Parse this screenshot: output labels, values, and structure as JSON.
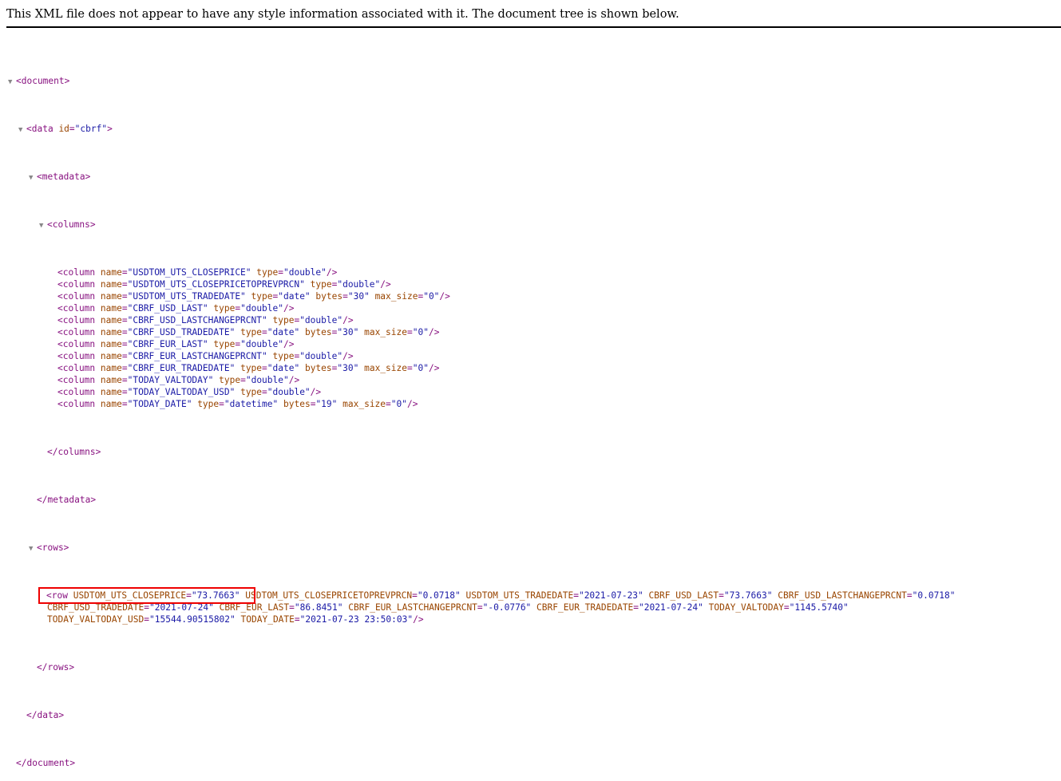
{
  "notice": "This XML file does not appear to have any style information associated with it. The document tree is shown below.",
  "document": {
    "open": "<document>",
    "close": "</document>"
  },
  "data": {
    "open_tag": "<data",
    "id_attr": "id",
    "id_value": "\"cbrf\"",
    "open_end": ">",
    "close": "</data>"
  },
  "metadata": {
    "open": "<metadata>",
    "close": "</metadata>"
  },
  "columns": {
    "open": "<columns>",
    "close": "</columns>",
    "items": [
      {
        "name": "\"USDTOM_UTS_CLOSEPRICE\"",
        "type": "\"double\""
      },
      {
        "name": "\"USDTOM_UTS_CLOSEPRICETOPREVPRCN\"",
        "type": "\"double\""
      },
      {
        "name": "\"USDTOM_UTS_TRADEDATE\"",
        "type": "\"date\"",
        "bytes": "\"30\"",
        "max_size": "\"0\""
      },
      {
        "name": "\"CBRF_USD_LAST\"",
        "type": "\"double\""
      },
      {
        "name": "\"CBRF_USD_LASTCHANGEPRCNT\"",
        "type": "\"double\""
      },
      {
        "name": "\"CBRF_USD_TRADEDATE\"",
        "type": "\"date\"",
        "bytes": "\"30\"",
        "max_size": "\"0\""
      },
      {
        "name": "\"CBRF_EUR_LAST\"",
        "type": "\"double\""
      },
      {
        "name": "\"CBRF_EUR_LASTCHANGEPRCNT\"",
        "type": "\"double\""
      },
      {
        "name": "\"CBRF_EUR_TRADEDATE\"",
        "type": "\"date\"",
        "bytes": "\"30\"",
        "max_size": "\"0\""
      },
      {
        "name": "\"TODAY_VALTODAY\"",
        "type": "\"double\""
      },
      {
        "name": "\"TODAY_VALTODAY_USD\"",
        "type": "\"double\""
      },
      {
        "name": "\"TODAY_DATE\"",
        "type": "\"datetime\"",
        "bytes": "\"19\"",
        "max_size": "\"0\""
      }
    ]
  },
  "rows": {
    "open": "<rows>",
    "close": "</rows>",
    "row": {
      "tag": "<row",
      "end": "/>",
      "attrs": [
        {
          "name": "USDTOM_UTS_CLOSEPRICE",
          "value": "\"73.7663\""
        },
        {
          "name": "USDTOM_UTS_CLOSEPRICETOPREVPRCN",
          "value": "\"0.0718\""
        },
        {
          "name": "USDTOM_UTS_TRADEDATE",
          "value": "\"2021-07-23\""
        },
        {
          "name": "CBRF_USD_LAST",
          "value": "\"73.7663\""
        },
        {
          "name": "CBRF_USD_LASTCHANGEPRCNT",
          "value": "\"0.0718\""
        },
        {
          "name": "CBRF_USD_TRADEDATE",
          "value": "\"2021-07-24\""
        },
        {
          "name": "CBRF_EUR_LAST",
          "value": "\"86.8451\""
        },
        {
          "name": "CBRF_EUR_LASTCHANGEPRCNT",
          "value": "\"-0.0776\""
        },
        {
          "name": "CBRF_EUR_TRADEDATE",
          "value": "\"2021-07-24\""
        },
        {
          "name": "TODAY_VALTODAY",
          "value": "\"1145.5740\""
        },
        {
          "name": "TODAY_VALTODAY_USD",
          "value": "\"15544.90515802\""
        },
        {
          "name": "TODAY_DATE",
          "value": "\"2021-07-23 23:50:03\""
        }
      ]
    }
  },
  "labels": {
    "column_tag": "<column",
    "name_attr": "name",
    "type_attr": "type",
    "bytes_attr": "bytes",
    "max_size_attr": "max_size",
    "self_close": "/>",
    "eq": "=",
    "toggle": "▼"
  },
  "colors": {
    "tag": "#881280",
    "attr_name": "#994500",
    "attr_value": "#1a1aa6",
    "highlight": "#e00000"
  }
}
